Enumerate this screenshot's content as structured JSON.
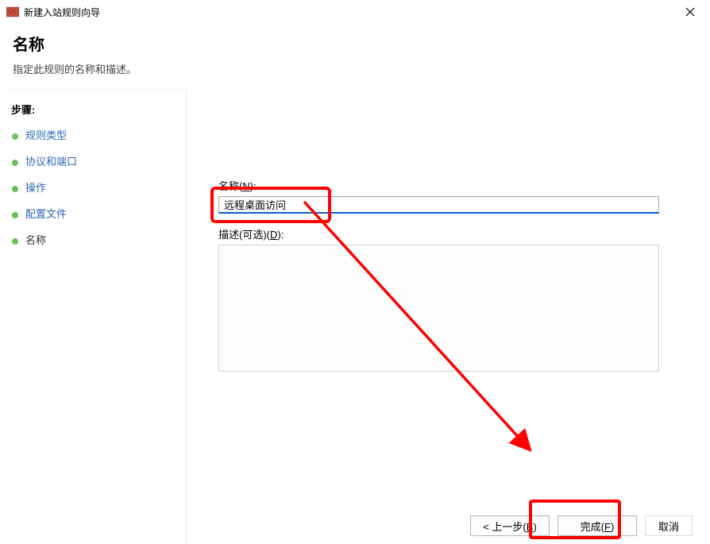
{
  "titlebar": {
    "title": "新建入站规则向导"
  },
  "header": {
    "title": "名称",
    "subtitle": "指定此规则的名称和描述。"
  },
  "sidebar": {
    "steps_label": "步骤:",
    "items": [
      {
        "label": "规则类型",
        "link": true
      },
      {
        "label": "协议和端口",
        "link": true
      },
      {
        "label": "操作",
        "link": true
      },
      {
        "label": "配置文件",
        "link": true
      },
      {
        "label": "名称",
        "link": false
      }
    ]
  },
  "main": {
    "name_label_prefix": "名称(",
    "name_label_key": "N",
    "name_label_suffix": "):",
    "name_value": "远程桌面访问",
    "desc_label_prefix": "描述(可选)(",
    "desc_label_key": "D",
    "desc_label_suffix": "):",
    "desc_value": ""
  },
  "buttons": {
    "back_prefix": "< 上一步(",
    "back_key": "B",
    "back_suffix": ")",
    "finish_prefix": "完成(",
    "finish_key": "F",
    "finish_suffix": ")",
    "cancel": "取消"
  }
}
